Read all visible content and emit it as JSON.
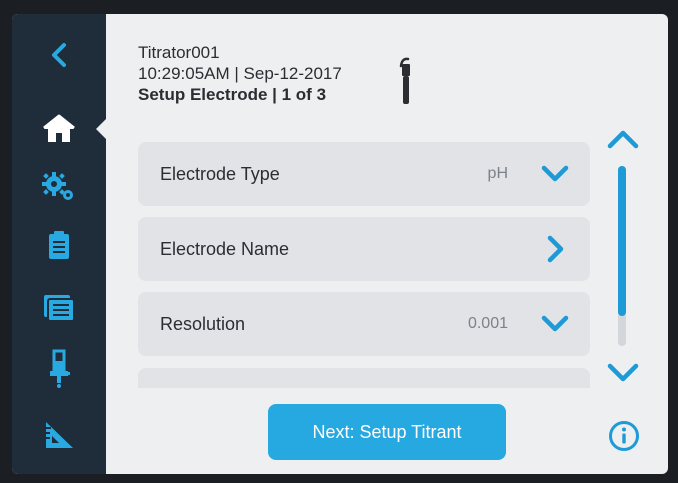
{
  "header": {
    "device_name": "Titrator001",
    "datetime": "10:29:05AM | Sep-12-2017",
    "step": "Setup Electrode | 1 of 3"
  },
  "sidebar": {
    "items": [
      {
        "icon": "back-chevron-icon"
      },
      {
        "icon": "home-icon",
        "active": true
      },
      {
        "icon": "settings-gears-icon"
      },
      {
        "icon": "clipboard-icon"
      },
      {
        "icon": "data-folder-icon"
      },
      {
        "icon": "burette-icon"
      },
      {
        "icon": "ruler-triangle-icon"
      }
    ]
  },
  "settings": {
    "rows": [
      {
        "label": "Electrode Type",
        "value": "pH",
        "control": "chevron-down-icon"
      },
      {
        "label": "Electrode Name",
        "value": "",
        "control": "chevron-right-icon"
      },
      {
        "label": "Resolution",
        "value": "0.001",
        "control": "chevron-down-icon"
      }
    ]
  },
  "scroll": {
    "position": 0
  },
  "actions": {
    "next_label": "Next: Setup Titrant"
  },
  "colors": {
    "accent": "#26a8e0",
    "sidebar": "#1f2d3b",
    "row_bg": "#e1e3e6"
  }
}
